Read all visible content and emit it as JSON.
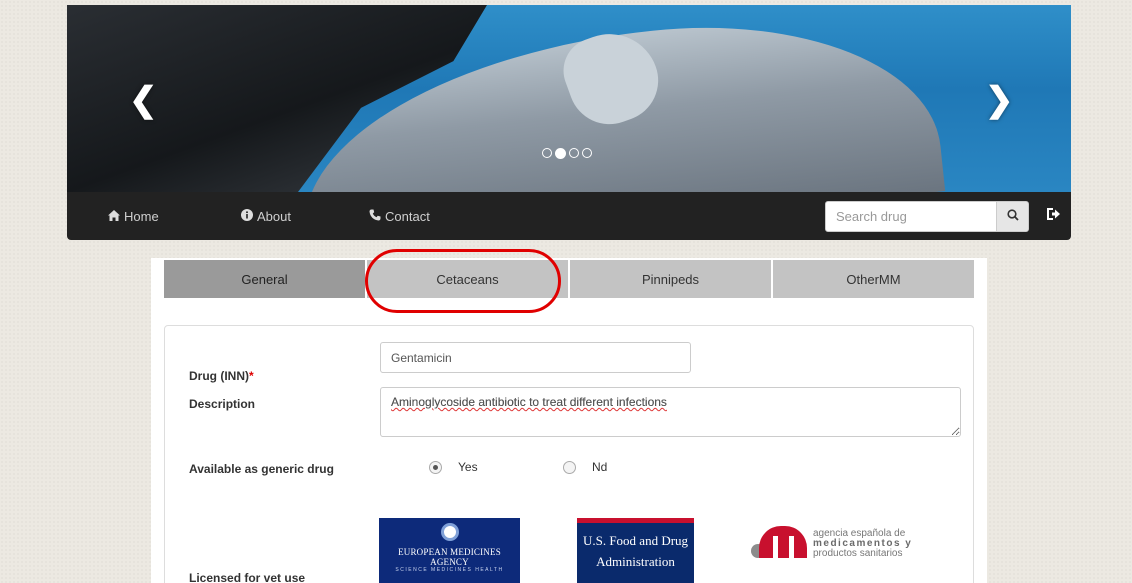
{
  "carousel": {
    "prev_icon": "chevron-left-icon",
    "next_icon": "chevron-right-icon",
    "slides": 4,
    "active_slide": 2
  },
  "nav": {
    "home": {
      "label": "Home",
      "icon": "home-icon"
    },
    "about": {
      "label": "About",
      "icon": "info-icon"
    },
    "contact": {
      "label": "Contact",
      "icon": "phone-icon"
    },
    "search_placeholder": "Search drug",
    "search_icon": "search-icon",
    "logout_icon": "logout-icon"
  },
  "tabs": [
    {
      "label": "General",
      "active": true
    },
    {
      "label": "Cetaceans",
      "active": false,
      "highlighted": true
    },
    {
      "label": "Pinnipeds",
      "active": false
    },
    {
      "label": "OtherMM",
      "active": false
    }
  ],
  "form": {
    "drug_label": "Drug (INN)",
    "required_mark": "*",
    "drug_value": "Gentamicin",
    "description_label": "Description",
    "description_value": "Aminoglycoside antibiotic to treat different infections",
    "generic_label": "Available as generic drug",
    "generic_options": [
      "Yes",
      "Nd"
    ],
    "generic_selected": "Yes",
    "licensed_label": "Licensed for vet use"
  },
  "logos": {
    "ema": {
      "line1": "EUROPEAN MEDICINES AGENCY",
      "line2": "SCIENCE  MEDICINES  HEALTH"
    },
    "fda": {
      "line1": "U.S. Food and Drug",
      "line2": "Administration"
    },
    "aemps": {
      "line1": "agencia española de",
      "line2": "medicamentos y",
      "line3": "productos sanitarios"
    }
  },
  "colors": {
    "navbar": "#222222",
    "tab_active": "#9a9a9a",
    "tab_inactive": "#c3c3c3",
    "highlight": "#e00000",
    "required": "#dd0000"
  }
}
